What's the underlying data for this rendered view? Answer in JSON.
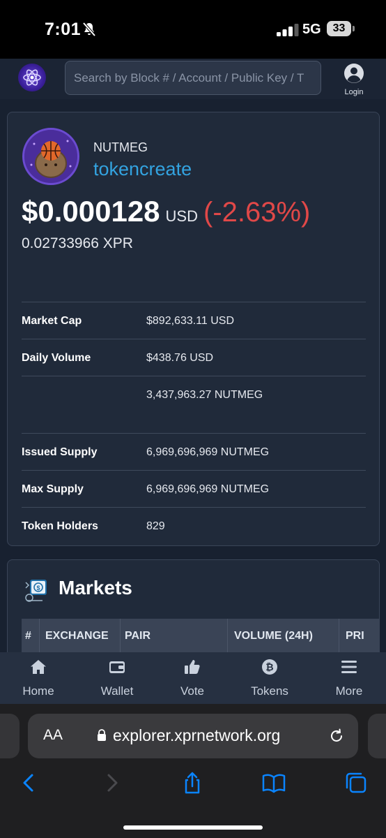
{
  "status_bar": {
    "time": "7:01",
    "network": "5G",
    "battery": "33"
  },
  "header": {
    "search_placeholder": "Search by Block # / Account / Public Key / T",
    "login_label": "Login"
  },
  "token": {
    "symbol": "NUTMEG",
    "contract": "tokencreate",
    "price_usd": "$0.000128",
    "price_unit": "USD",
    "price_change": "(-2.63%)",
    "price_xpr": "0.02733966 XPR"
  },
  "stats": {
    "market_cap_label": "Market Cap",
    "market_cap_value": "$892,633.11 USD",
    "daily_volume_label": "Daily Volume",
    "daily_volume_usd": "$438.76 USD",
    "daily_volume_token": "3,437,963.27 NUTMEG",
    "issued_supply_label": "Issued Supply",
    "issued_supply_value": "6,969,696,969 NUTMEG",
    "max_supply_label": "Max Supply",
    "max_supply_value": "6,969,696,969 NUTMEG",
    "holders_label": "Token Holders",
    "holders_value": "829"
  },
  "markets": {
    "title": "Markets",
    "columns": [
      "#",
      "EXCHANGE",
      "PAIR",
      "VOLUME (24H)",
      "PRI"
    ]
  },
  "bottom_nav": {
    "items": [
      {
        "label": "Home",
        "icon": "home-icon"
      },
      {
        "label": "Wallet",
        "icon": "wallet-icon"
      },
      {
        "label": "Vote",
        "icon": "thumbs-up-icon"
      },
      {
        "label": "Tokens",
        "icon": "bitcoin-icon"
      },
      {
        "label": "More",
        "icon": "menu-icon"
      }
    ]
  },
  "browser": {
    "aa_label": "AA",
    "url": "explorer.xprnetwork.org"
  },
  "colors": {
    "accent_blue": "#33a3e0",
    "negative_red": "#e04848",
    "card_bg": "#202a3a",
    "ios_blue": "#0a84ff"
  }
}
